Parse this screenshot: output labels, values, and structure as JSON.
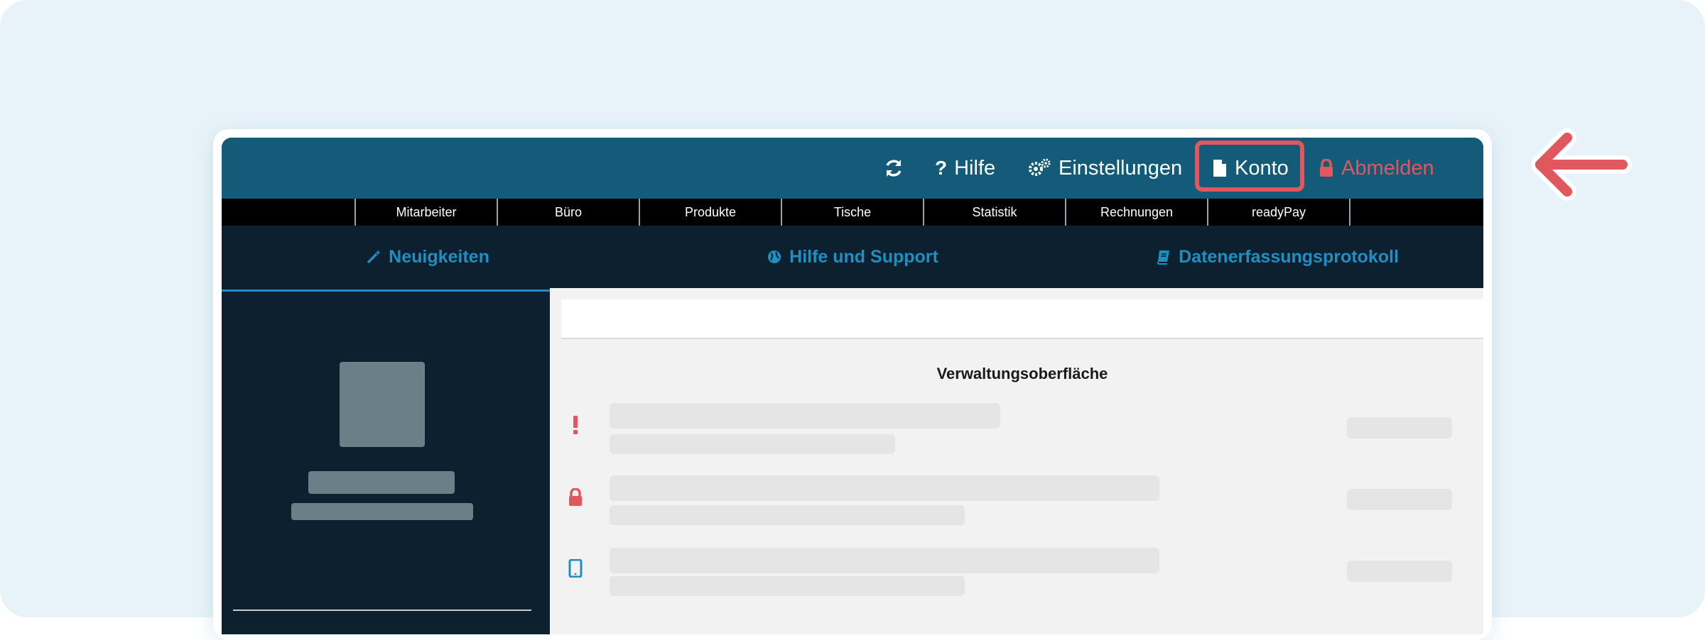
{
  "topbar": {
    "refresh_icon": "refresh-icon",
    "help_label": "Hilfe",
    "settings_label": "Einstellungen",
    "account_label": "Konto",
    "logout_label": "Abmelden"
  },
  "menu": [
    "Mitarbeiter",
    "Büro",
    "Produkte",
    "Tische",
    "Statistik",
    "Rechnungen",
    "readyPay"
  ],
  "tabs": [
    {
      "label": "Neuigkeiten",
      "icon": "magic-wand-icon",
      "active": true
    },
    {
      "label": "Hilfe und Support",
      "icon": "globe-icon",
      "active": false
    },
    {
      "label": "Datenerfassungsprotokoll",
      "icon": "book-icon",
      "active": false
    }
  ],
  "content": {
    "section_title": "Verwaltungsoberfläche",
    "rows": [
      {
        "icon": "exclamation-icon",
        "color": "#e0575d"
      },
      {
        "icon": "lock-icon",
        "color": "#e0575d"
      },
      {
        "icon": "tablet-icon",
        "color": "#1e8fc0"
      }
    ]
  },
  "colors": {
    "topbar": "#135b78",
    "accent": "#1e8fc0",
    "danger": "#e0575d",
    "highlight": "#e0575d"
  }
}
